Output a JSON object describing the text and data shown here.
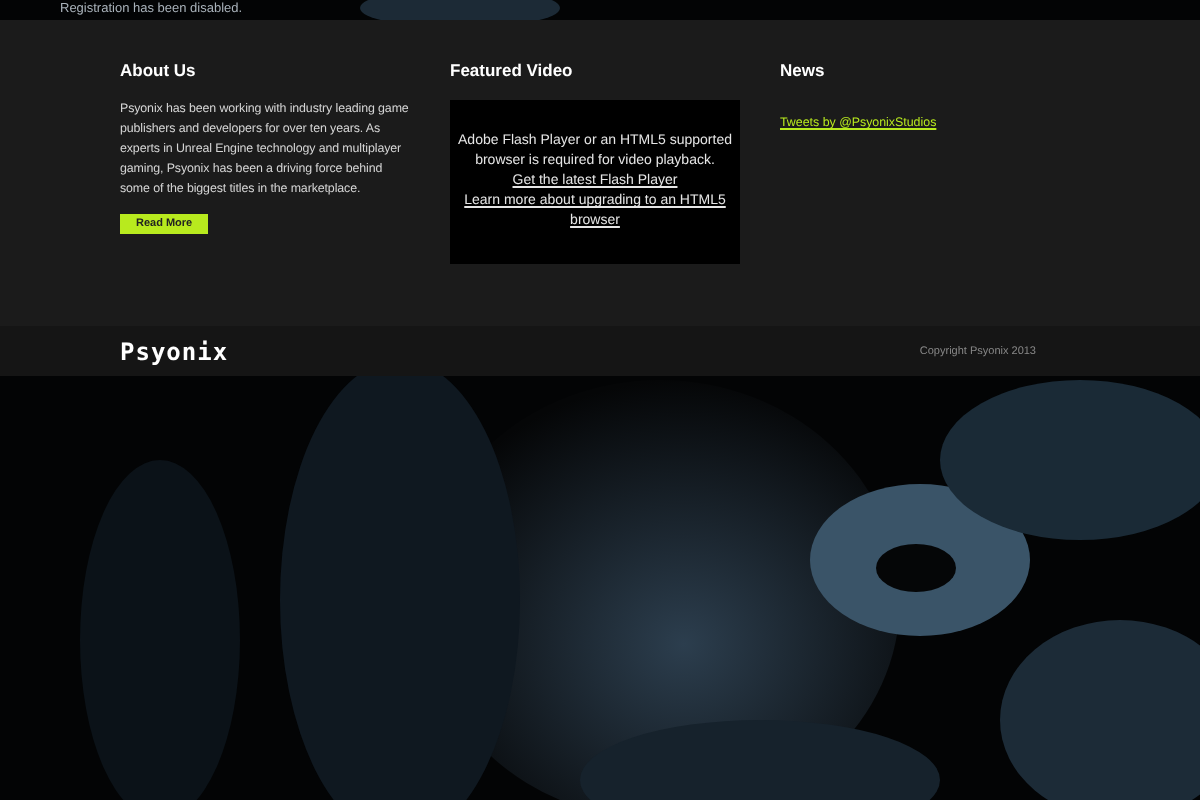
{
  "notice": "Registration has been disabled.",
  "about": {
    "title": "About Us",
    "text": "Psyonix has been working with industry leading game publishers and developers for over ten years. As experts in Unreal Engine technology and multiplayer gaming, Psyonix has been a driving force behind some of the biggest titles in the marketplace.",
    "button": "Read More"
  },
  "video": {
    "title": "Featured Video",
    "message": "Adobe Flash Player or an HTML5 supported browser is required for video playback.",
    "links": [
      "Get the latest Flash Player",
      "Learn more about upgrading to an HTML5 browser"
    ]
  },
  "news": {
    "title": "News",
    "link": "Tweets by @PsyonixStudios"
  },
  "footer": {
    "logo": "Psyonix",
    "copyright": "Copyright Psyonix 2013"
  }
}
